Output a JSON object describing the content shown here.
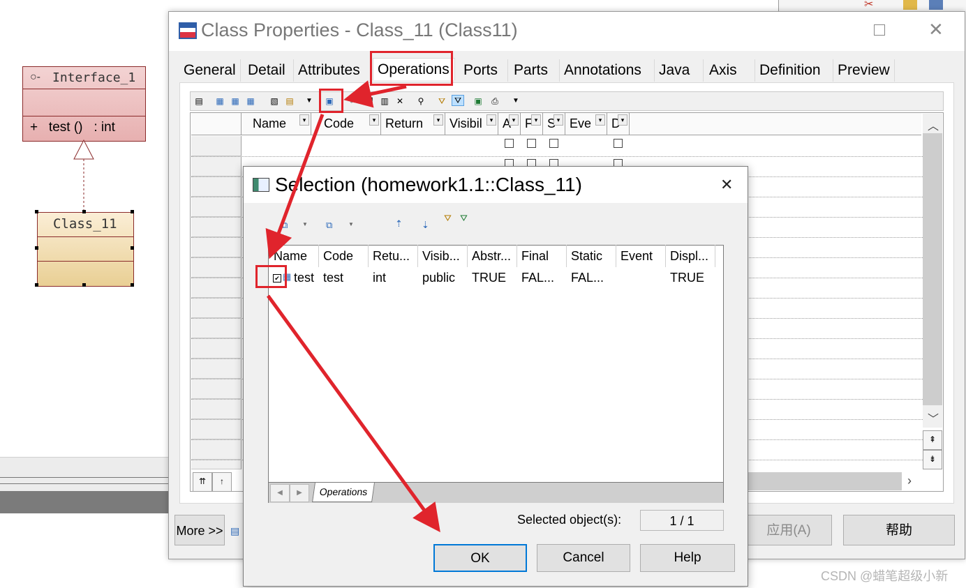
{
  "diagram": {
    "interface": {
      "name": "Interface_1",
      "operation": "+   test ()   : int"
    },
    "class": {
      "name": "Class_11"
    }
  },
  "window": {
    "title": "Class Properties - Class_11 (Class11)",
    "tabs": [
      "General",
      "Detail",
      "Attributes",
      "Operations",
      "Ports",
      "Parts",
      "Annotations",
      "Java",
      "Axis",
      "Definition",
      "Preview"
    ],
    "columns": [
      "Name",
      "Code",
      "Return",
      "Visibil",
      "A",
      "F",
      "S",
      "Eve",
      "D"
    ],
    "buttons": {
      "more": "More >>",
      "apply": "应用(A)",
      "help": "帮助"
    }
  },
  "selection": {
    "title": "Selection (homework1.1::Class_11)",
    "columns": [
      "Name",
      "Code",
      "Retu...",
      "Visib...",
      "Abstr...",
      "Final",
      "Static",
      "Event",
      "Displ..."
    ],
    "row": {
      "name": "test",
      "code": "test",
      "return": "int",
      "visibility": "public",
      "abstract": "TRUE",
      "final": "FAL...",
      "static": "FAL...",
      "event": "",
      "display": "TRUE"
    },
    "sheet_tab": "Operations",
    "selected_label": "Selected object(s):",
    "selected_value": "1 / 1",
    "buttons": {
      "ok": "OK",
      "cancel": "Cancel",
      "help": "Help"
    }
  },
  "watermark": "CSDN @蜡笔超级小新",
  "colors": {
    "annotation": "#e0242c",
    "ok_border": "#0078d7"
  }
}
